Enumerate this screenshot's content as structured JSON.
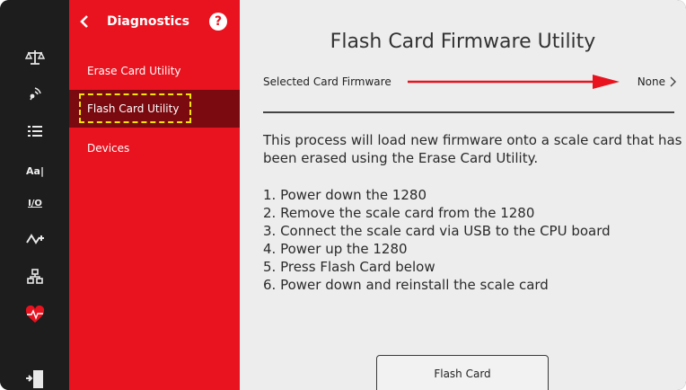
{
  "rail": {
    "icons": [
      "scale-icon",
      "wireless-icon",
      "list-icon",
      "text-size-icon",
      "io-icon",
      "routing-icon",
      "network-icon",
      "heart-pulse-icon",
      "door-exit-icon"
    ],
    "text_size_label": "Aa|",
    "io_label": "I/O"
  },
  "nav": {
    "title": "Diagnostics",
    "help": "?",
    "items": [
      {
        "label": "Erase Card Utility"
      },
      {
        "label": "Flash Card Utility"
      },
      {
        "label": "Devices"
      }
    ],
    "selected_index": 1,
    "accent_color": "#e8131f",
    "selected_color": "#7a0a10"
  },
  "main": {
    "title": "Flash Card Firmware Utility",
    "setting": {
      "label": "Selected Card Firmware",
      "value": "None"
    },
    "description": "This process will load new firmware onto a scale card that has been erased using the Erase Card Utility.",
    "steps": [
      "1. Power down the 1280",
      "2. Remove the scale card from the 1280",
      "3. Connect the scale card via USB to the CPU board",
      "4. Power up the 1280",
      "5. Press Flash Card below",
      "6. Power down and reinstall the scale card"
    ],
    "button_label": "Flash Card"
  },
  "annotations": {
    "arrow_color": "#e8131f",
    "highlight_color": "#f4e400"
  }
}
